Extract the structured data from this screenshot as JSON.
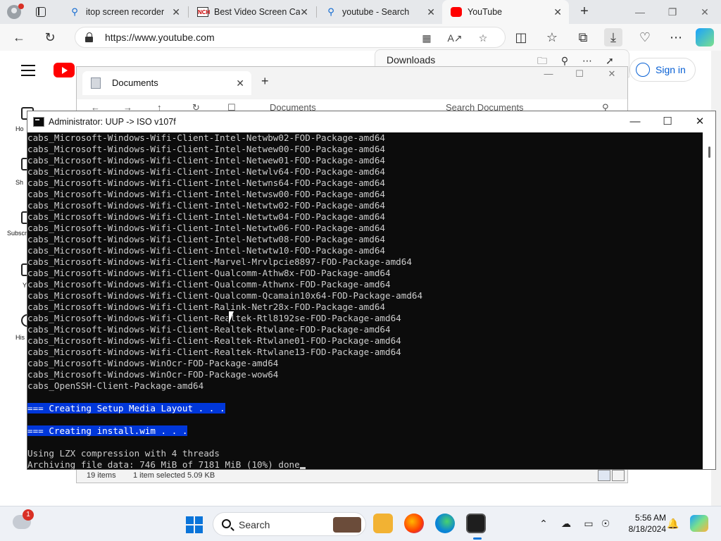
{
  "browser": {
    "tabs": [
      {
        "label": "itop screen recorder",
        "icon": "search-icon",
        "active": false
      },
      {
        "label": "Best Video Screen Ca",
        "icon": "nch-logo-icon",
        "active": false
      },
      {
        "label": "youtube - Search",
        "icon": "search-icon",
        "active": false
      },
      {
        "label": "YouTube",
        "icon": "youtube-icon",
        "active": true
      }
    ],
    "url": "https://www.youtube.com"
  },
  "youtube": {
    "sign_in": "Sign in",
    "side_items": [
      "Ho",
      "Sh",
      "Subscri",
      "Y",
      "His"
    ]
  },
  "downloads": {
    "title": "Downloads"
  },
  "explorer": {
    "tab_title": "Documents",
    "breadcrumb": "Documents",
    "search_placeholder": "Search Documents",
    "status_items": "19 items",
    "status_selected": "1 item selected  5.09 KB"
  },
  "console": {
    "title": "Administrator:  UUP -> ISO v107f",
    "lines": [
      "cabs_Microsoft-Windows-Wifi-Client-Intel-Netwbw02-FOD-Package-amd64",
      "cabs_Microsoft-Windows-Wifi-Client-Intel-Netwew00-FOD-Package-amd64",
      "cabs_Microsoft-Windows-Wifi-Client-Intel-Netwew01-FOD-Package-amd64",
      "cabs_Microsoft-Windows-Wifi-Client-Intel-Netwlv64-FOD-Package-amd64",
      "cabs_Microsoft-Windows-Wifi-Client-Intel-Netwns64-FOD-Package-amd64",
      "cabs_Microsoft-Windows-Wifi-Client-Intel-Netwsw00-FOD-Package-amd64",
      "cabs_Microsoft-Windows-Wifi-Client-Intel-Netwtw02-FOD-Package-amd64",
      "cabs_Microsoft-Windows-Wifi-Client-Intel-Netwtw04-FOD-Package-amd64",
      "cabs_Microsoft-Windows-Wifi-Client-Intel-Netwtw06-FOD-Package-amd64",
      "cabs_Microsoft-Windows-Wifi-Client-Intel-Netwtw08-FOD-Package-amd64",
      "cabs_Microsoft-Windows-Wifi-Client-Intel-Netwtw10-FOD-Package-amd64",
      "cabs_Microsoft-Windows-Wifi-Client-Marvel-Mrvlpcie8897-FOD-Package-amd64",
      "cabs_Microsoft-Windows-Wifi-Client-Qualcomm-Athw8x-FOD-Package-amd64",
      "cabs_Microsoft-Windows-Wifi-Client-Qualcomm-Athwnx-FOD-Package-amd64",
      "cabs_Microsoft-Windows-Wifi-Client-Qualcomm-Qcamain10x64-FOD-Package-amd64",
      "cabs_Microsoft-Windows-Wifi-Client-Ralink-Netr28x-FOD-Package-amd64",
      "cabs_Microsoft-Windows-Wifi-Client-Realtek-Rtl8192se-FOD-Package-amd64",
      "cabs_Microsoft-Windows-Wifi-Client-Realtek-Rtwlane-FOD-Package-amd64",
      "cabs_Microsoft-Windows-Wifi-Client-Realtek-Rtwlane01-FOD-Package-amd64",
      "cabs_Microsoft-Windows-Wifi-Client-Realtek-Rtwlane13-FOD-Package-amd64",
      "cabs_Microsoft-Windows-WinOcr-FOD-Package-amd64",
      "cabs_Microsoft-Windows-WinOcr-FOD-Package-wow64",
      "cabs_OpenSSH-Client-Package-amd64",
      "",
      "=== Creating Setup Media Layout . . .",
      "",
      "=== Creating install.wim . . .",
      "",
      "Using LZX compression with 4 threads",
      "Archiving file data: 746 MiB of 7181 MiB (10%) done"
    ],
    "highlighted": [
      24,
      26
    ]
  },
  "taskbar": {
    "notification_count": "1",
    "search_label": "Search",
    "time": "5:56 AM",
    "date": "8/18/2024"
  },
  "colors": {
    "console_bg": "#0c0c0c",
    "console_fg": "#cccccc",
    "selection": "#0037da",
    "accent": "#0a74d9",
    "youtube_red": "#ff0000"
  }
}
